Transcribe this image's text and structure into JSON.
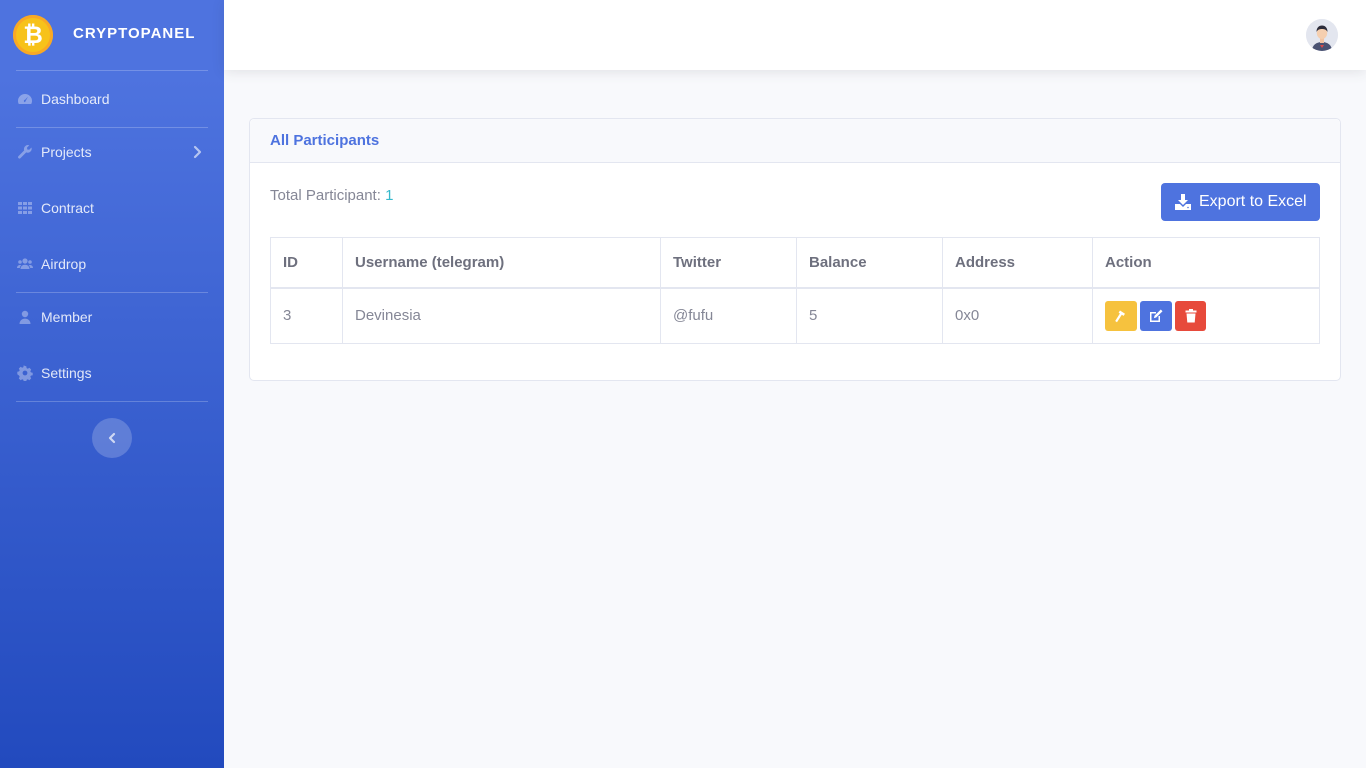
{
  "brand": {
    "name": "CRYPTOPANEL",
    "logo_icon": "bitcoin-icon",
    "logo_symbol": "₿"
  },
  "sidebar": {
    "items": [
      {
        "label": "Dashboard",
        "icon": "tachometer-icon"
      },
      {
        "label": "Projects",
        "icon": "wrench-icon",
        "has_submenu": true
      },
      {
        "label": "Contract",
        "icon": "grid-icon"
      },
      {
        "label": "Airdrop",
        "icon": "users-icon"
      },
      {
        "label": "Member",
        "icon": "user-icon"
      },
      {
        "label": "Settings",
        "icon": "gear-icon"
      }
    ],
    "toggle_icon": "chevron-left-icon"
  },
  "topbar": {
    "avatar_icon": "user-avatar"
  },
  "card": {
    "title": "All Participants",
    "total_label": "Total Participant: ",
    "total_count": "1",
    "export_label": "Export to Excel",
    "export_icon": "download-icon"
  },
  "table": {
    "headers": [
      "ID",
      "Username (telegram)",
      "Twitter",
      "Balance",
      "Address",
      "Action"
    ],
    "rows": [
      {
        "id": "3",
        "username": "Devinesia",
        "twitter": "@fufu",
        "balance": "5",
        "address": "0x0"
      }
    ],
    "actions": [
      {
        "name": "hammer-icon",
        "color": "#f6c23e"
      },
      {
        "name": "edit-icon",
        "color": "#4e73df"
      },
      {
        "name": "trash-icon",
        "color": "#e74a3b"
      }
    ]
  },
  "colors": {
    "primary": "#4e73df",
    "warning": "#f6c23e",
    "danger": "#e74a3b",
    "info": "#36b9cc"
  }
}
